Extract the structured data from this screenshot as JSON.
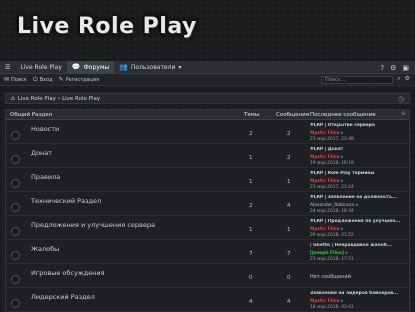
{
  "logo": "Live Role Play",
  "navbar": {
    "menu_icon": "hamburger-icon",
    "items": [
      {
        "label": "Live Role Play",
        "active": false
      },
      {
        "label": "Форумы",
        "active": true
      },
      {
        "label": "Пользователи",
        "active": false
      }
    ]
  },
  "subnav": {
    "items": [
      {
        "icon": "mail-icon",
        "label": "Поиск"
      },
      {
        "icon": "login-icon",
        "label": "Вход"
      },
      {
        "icon": "register-icon",
        "label": "Регистрация"
      }
    ],
    "search_placeholder": "Поиск..."
  },
  "breadcrumb": {
    "items": [
      "Live Role Play",
      "Live Role Play"
    ]
  },
  "table": {
    "headers": {
      "title": "Общий Раздел",
      "topics": "Темы",
      "messages": "Сообщения",
      "last": "Последнее сообщение"
    },
    "rows": [
      {
        "name": "Новости",
        "topics": "2",
        "messages": "2",
        "last_title": "#LRP | Открытие сервера",
        "last_user": "Mystic Flinx",
        "user_color": "red",
        "last_date": "23 мар 2017, 23:48"
      },
      {
        "name": "Донат",
        "topics": "1",
        "messages": "2",
        "last_title": "#LRP | Донат",
        "last_user": "Mystic Flinx",
        "user_color": "red",
        "last_date": "19 мар 2018, 16:19"
      },
      {
        "name": "Правила",
        "topics": "1",
        "messages": "1",
        "last_title": "#LRP | Role Play термины",
        "last_user": "Mystic Flinx",
        "user_color": "red",
        "last_date": "23 мар 2017, 21:24"
      },
      {
        "name": "Технический Раздел",
        "topics": "2",
        "messages": "4",
        "last_title": "#LRP | Заявление на должность...",
        "last_user": "Alexander_Robinson",
        "user_color": "plain",
        "last_date": "24 мар 2018, 18:34"
      },
      {
        "name": "Предложения и улучшения сервера",
        "topics": "1",
        "messages": "1",
        "last_title": "#LRP | Предложения по улучшен...",
        "last_user": "Mystic Flinx",
        "user_color": "red",
        "last_date": "26 мар 2018, 21:52"
      },
      {
        "name": "Жалобы",
        "topics": "7",
        "messages": "7",
        "last_title": "| Ghetto | Неправдивое жалоб...",
        "last_user": "[Joseph Flinx]",
        "user_color": "green",
        "last_date": "23 мар 2018, 17:51"
      },
      {
        "name": "Игровые обсуждения",
        "topics": "0",
        "messages": "0",
        "last_title": "",
        "last_user": "",
        "user_color": "",
        "last_date": "",
        "none": "Нет сообщений"
      },
      {
        "name": "Лидерский Раздел",
        "topics": "4",
        "messages": "4",
        "last_title": "Заявления на лидеров байкеров...",
        "last_user": "Mystic Flinx",
        "user_color": "red",
        "last_date": "18 мар 2018, 03:41"
      }
    ]
  }
}
